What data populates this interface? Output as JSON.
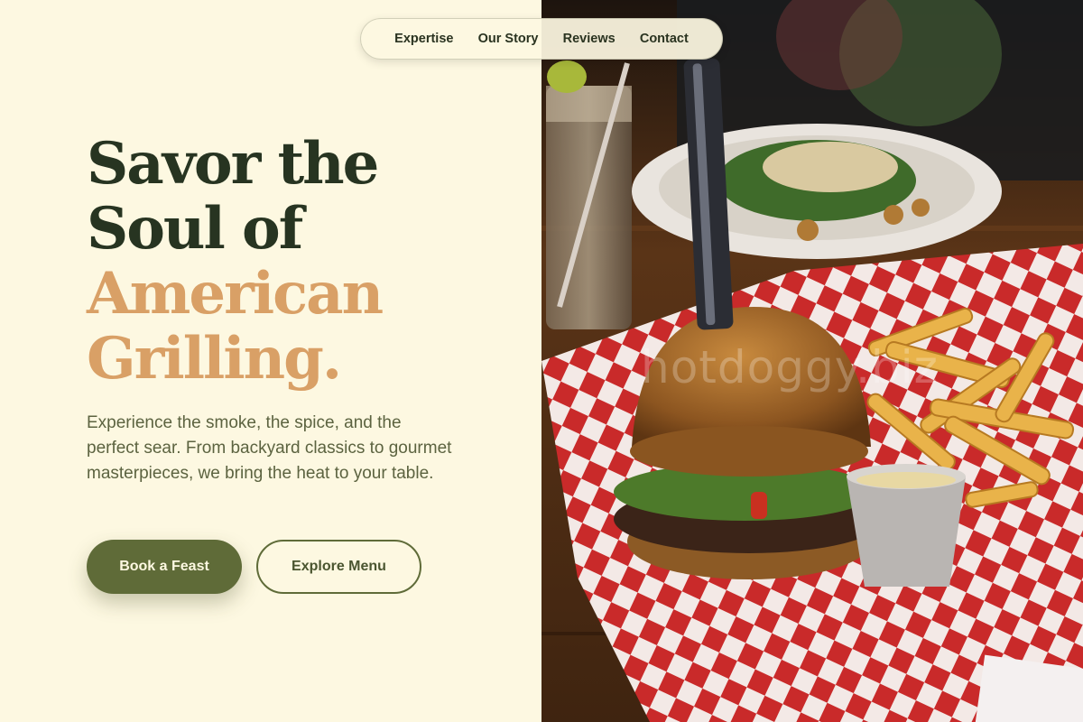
{
  "nav": {
    "items": [
      {
        "label": "Expertise"
      },
      {
        "label": "Our Story"
      },
      {
        "label": "Reviews"
      },
      {
        "label": "Contact"
      }
    ]
  },
  "hero": {
    "title_line1": "Savor the",
    "title_line2": "Soul of",
    "title_line3": "American",
    "title_line4": "Grilling.",
    "description": "Experience the smoke, the spice, and the perfect sear. From backyard classics to gourmet masterpieces, we bring the heat to your table.",
    "primary_button": "Book a Feast",
    "secondary_button": "Explore Menu"
  },
  "image": {
    "watermark": "hotdoggy.biz",
    "subject": "burger-with-fries-photo"
  },
  "colors": {
    "background": "#fdf8e1",
    "headline_dark": "#273421",
    "headline_accent": "#d9a066",
    "body_text": "#5c6340",
    "button_primary": "#5f6b38"
  }
}
